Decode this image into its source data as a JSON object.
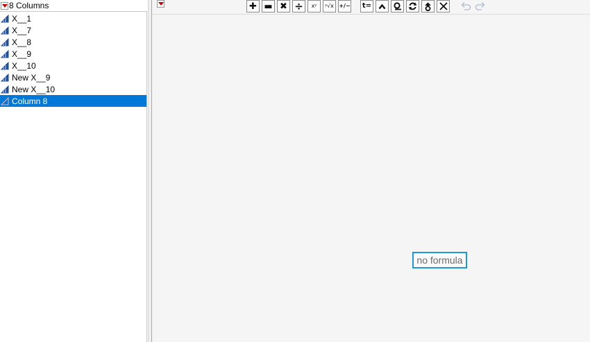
{
  "columns_panel": {
    "header": "8 Columns",
    "items": [
      {
        "label": "X__1",
        "selected": false,
        "icon": "continuous-column-icon"
      },
      {
        "label": "X__7",
        "selected": false,
        "icon": "continuous-column-icon"
      },
      {
        "label": "X__8",
        "selected": false,
        "icon": "continuous-column-icon"
      },
      {
        "label": "X__9",
        "selected": false,
        "icon": "continuous-column-icon"
      },
      {
        "label": "X__10",
        "selected": false,
        "icon": "continuous-column-icon"
      },
      {
        "label": "New X__9",
        "selected": false,
        "icon": "continuous-column-icon"
      },
      {
        "label": "New X__10",
        "selected": false,
        "icon": "continuous-column-icon"
      },
      {
        "label": "Column 8",
        "selected": true,
        "icon": "continuous-column-icon"
      }
    ]
  },
  "toolbar": {
    "buttons": [
      {
        "name": "add-button",
        "icon": "plus-icon",
        "glyph": "✚"
      },
      {
        "name": "subtract-button",
        "icon": "minus-icon",
        "glyph": "▬"
      },
      {
        "name": "multiply-button",
        "icon": "times-icon",
        "glyph": "✖"
      },
      {
        "name": "divide-button",
        "icon": "divide-icon",
        "glyph": "÷"
      },
      {
        "name": "power-button",
        "icon": "power-icon",
        "glyph": "xʸ"
      },
      {
        "name": "root-button",
        "icon": "root-icon",
        "glyph": "ʸ√x"
      },
      {
        "name": "sign-button",
        "icon": "plus-minus-icon",
        "glyph": "+/−"
      },
      {
        "name": "assign-button",
        "icon": "assign-icon",
        "glyph": "t="
      },
      {
        "name": "raise-button",
        "icon": "caret-up-icon",
        "glyph": ""
      },
      {
        "name": "local-variable-button",
        "icon": "loop-icon",
        "glyph": ""
      },
      {
        "name": "swap-button",
        "icon": "swap-icon",
        "glyph": ""
      },
      {
        "name": "peel-button",
        "icon": "peel-icon",
        "glyph": ""
      },
      {
        "name": "delete-button",
        "icon": "x-icon",
        "glyph": ""
      }
    ],
    "undo_icon": "undo-icon",
    "redo_icon": "redo-icon"
  },
  "editor": {
    "placeholder": "no formula"
  },
  "colors": {
    "selection": "#0078d7",
    "focus_border": "#1a9ad6",
    "menu_triangle": "#cc0000",
    "column_icon": "#1f4e9c"
  }
}
